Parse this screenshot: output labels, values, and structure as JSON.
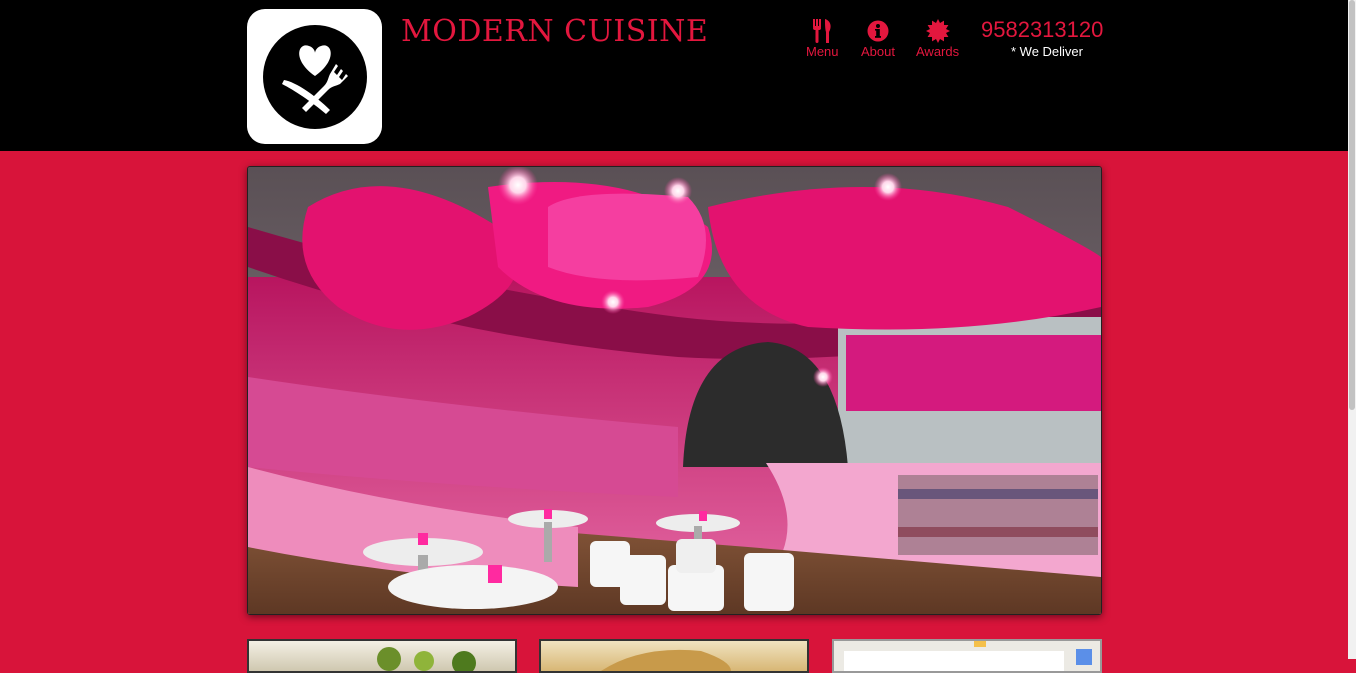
{
  "site": {
    "title": "MODERN CUISINE",
    "phone": "9582313120",
    "deliver_note": "* We Deliver"
  },
  "nav": {
    "items": [
      {
        "label": "Menu",
        "icon": "fork-knife-icon"
      },
      {
        "label": "About",
        "icon": "info-icon"
      },
      {
        "label": "Awards",
        "icon": "award-badge-icon"
      }
    ]
  },
  "colors": {
    "brand_red": "#e3173e",
    "page_background": "#d8143a",
    "header_background": "#000000"
  },
  "hero": {
    "image": "restaurant-interior-photo"
  },
  "cards": [
    {
      "image": "food-dish-photo"
    },
    {
      "image": "pastry-photo"
    },
    {
      "image": "map-embed"
    }
  ]
}
